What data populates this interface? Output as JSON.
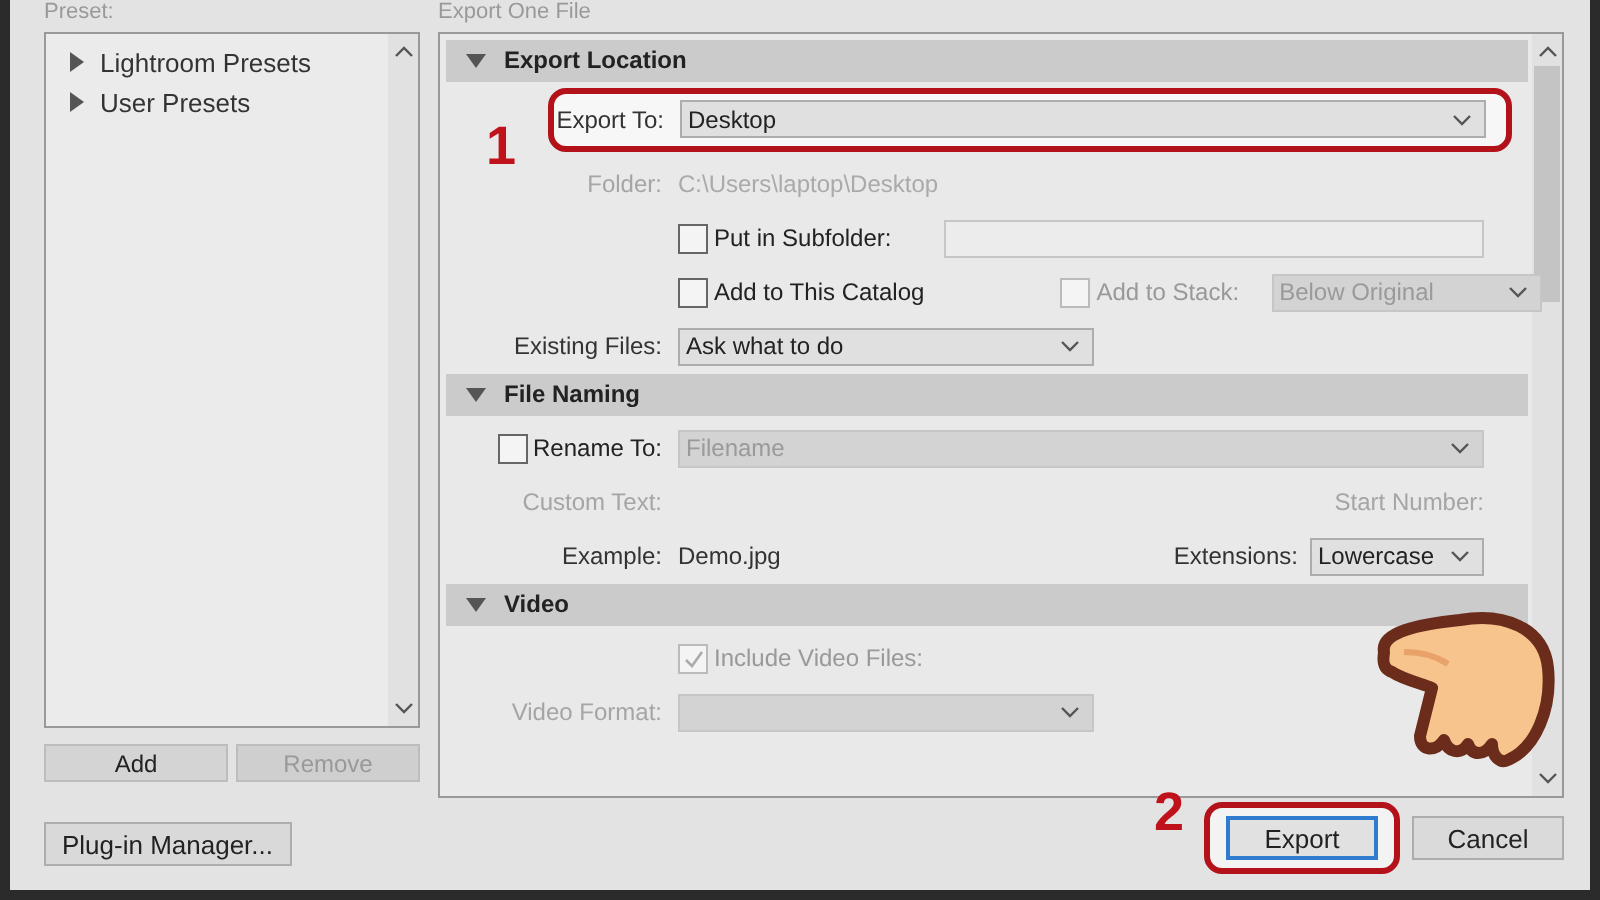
{
  "presets": {
    "label": "Preset:",
    "items": [
      {
        "label": "Lightroom Presets",
        "expanded": false
      },
      {
        "label": "User Presets",
        "expanded": false
      }
    ],
    "buttons": [
      {
        "label": "Add",
        "disabled": false
      },
      {
        "label": "Remove",
        "disabled": true
      }
    ]
  },
  "plugin_manager": "Plug-in Manager...",
  "export": {
    "label": "Export One File",
    "sections": [
      {
        "title": "Export Location",
        "expanded": true,
        "rows": [
          {
            "callout": "1",
            "lead": {
              "kind": "label",
              "text": "Export To:",
              "disabled": false
            },
            "items": [
              {
                "kind": "wide-dropdown",
                "text": "Desktop",
                "disabled": false
              }
            ]
          },
          {
            "lead": {
              "kind": "label",
              "text": "Folder:",
              "disabled": true
            },
            "items": [
              {
                "kind": "text",
                "text": "C:\\Users\\laptop\\Desktop",
                "disabled": true
              }
            ]
          },
          {
            "items": [
              {
                "kind": "checkbox",
                "text": "Put in Subfolder:",
                "checked": false,
                "disabled": false
              },
              {
                "kind": "input",
                "disabled": false
              }
            ]
          },
          {
            "items": [
              {
                "kind": "checkbox",
                "text": "Add to This Catalog",
                "checked": false,
                "disabled": false
              },
              {
                "kind": "checkbox",
                "text": "Add to Stack:",
                "checked": false,
                "disabled": true
              },
              {
                "kind": "dropdown",
                "text": "Below Original",
                "disabled": true
              }
            ]
          },
          {
            "lead": {
              "kind": "label",
              "text": "Existing Files:",
              "disabled": false
            },
            "items": [
              {
                "kind": "dropdown",
                "text": "Ask what to do",
                "disabled": false
              }
            ]
          }
        ]
      },
      {
        "title": "File Naming",
        "expanded": true,
        "rows": [
          {
            "lead": {
              "kind": "checkbox",
              "text": "Rename To:",
              "checked": false,
              "disabled": false
            },
            "items": [
              {
                "kind": "wide-dropdown",
                "text": "Filename",
                "disabled": true
              }
            ]
          },
          {
            "lead": {
              "kind": "label",
              "text": "Custom Text:",
              "disabled": true
            },
            "items": [],
            "right": [
              {
                "kind": "label",
                "text": "Start Number:",
                "disabled": true
              }
            ]
          },
          {
            "lead": {
              "kind": "label",
              "text": "Example:",
              "disabled": false
            },
            "items": [
              {
                "kind": "text",
                "text": "Demo.jpg",
                "disabled": false
              }
            ],
            "right": [
              {
                "kind": "label",
                "text": "Extensions:",
                "disabled": false
              },
              {
                "kind": "dropdown",
                "text": "Lowercase",
                "disabled": false
              }
            ]
          }
        ]
      },
      {
        "title": "Video",
        "expanded": true,
        "rows": [
          {
            "items": [
              {
                "kind": "checkbox",
                "text": "Include Video Files:",
                "checked": true,
                "disabled": true
              }
            ]
          },
          {
            "lead": {
              "kind": "label",
              "text": "Video Format:",
              "disabled": true
            },
            "items": [
              {
                "kind": "dropdown",
                "disabled": true
              }
            ]
          }
        ]
      }
    ]
  },
  "buttons": [
    {
      "label": "Export",
      "focused": true,
      "callout": "2"
    },
    {
      "label": "Cancel",
      "focused": false
    }
  ]
}
